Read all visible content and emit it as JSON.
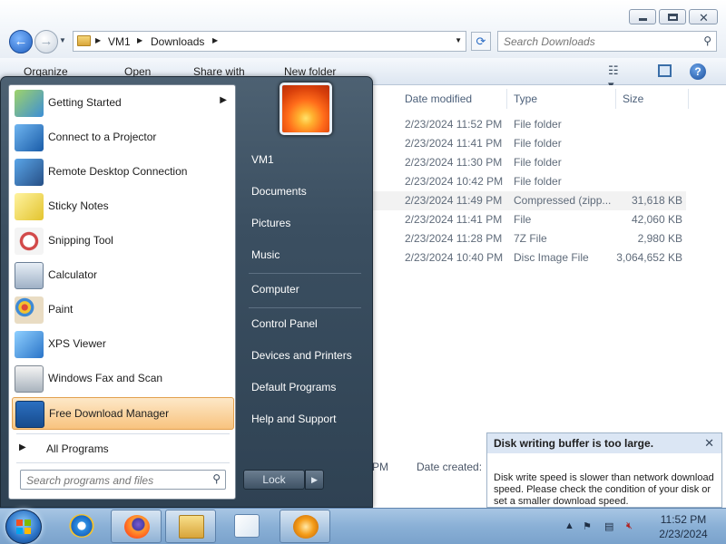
{
  "explorer": {
    "address": {
      "crumbs": [
        "VM1",
        "Downloads"
      ]
    },
    "search": {
      "placeholder": "Search Downloads"
    },
    "toolbar": {
      "organize": "Organize",
      "open": "Open",
      "share_with": "Share with",
      "new_folder": "New folder"
    },
    "columns": {
      "date_modified": "Date modified",
      "type": "Type",
      "size": "Size"
    },
    "files": [
      {
        "date": "2/23/2024 11:52 PM",
        "type": "File folder",
        "size": ""
      },
      {
        "date": "2/23/2024 11:41 PM",
        "type": "File folder",
        "size": ""
      },
      {
        "date": "2/23/2024 11:30 PM",
        "type": "File folder",
        "size": ""
      },
      {
        "date": "2/23/2024 10:42 PM",
        "type": "File folder",
        "size": ""
      },
      {
        "date": "2/23/2024 11:49 PM",
        "type": "Compressed (zipp...",
        "size": "31,618 KB"
      },
      {
        "date": "2/23/2024 11:41 PM",
        "type": "File",
        "size": "42,060 KB"
      },
      {
        "date": "2/23/2024 11:28 PM",
        "type": "7Z File",
        "size": "2,980 KB"
      },
      {
        "date": "2/23/2024 10:40 PM",
        "type": "Disc Image File",
        "size": "3,064,652 KB"
      }
    ],
    "details": {
      "time_fragment": "PM",
      "date_created_label": "Date created:"
    }
  },
  "start_menu": {
    "programs": [
      {
        "label": "Getting Started",
        "icon": "getting-started-icon"
      },
      {
        "label": "Connect to a Projector",
        "icon": "projector-icon"
      },
      {
        "label": "Remote Desktop Connection",
        "icon": "remote-desktop-icon"
      },
      {
        "label": "Sticky Notes",
        "icon": "sticky-notes-icon"
      },
      {
        "label": "Snipping Tool",
        "icon": "snipping-tool-icon"
      },
      {
        "label": "Calculator",
        "icon": "calculator-icon"
      },
      {
        "label": "Paint",
        "icon": "paint-icon"
      },
      {
        "label": "XPS Viewer",
        "icon": "xps-viewer-icon"
      },
      {
        "label": "Windows Fax and Scan",
        "icon": "fax-scan-icon"
      },
      {
        "label": "Free Download Manager",
        "icon": "free-download-manager-icon"
      }
    ],
    "all_programs": "All Programs",
    "search_placeholder": "Search programs and files",
    "right_items": [
      "VM1",
      "Documents",
      "Pictures",
      "Music",
      "Computer",
      "Control Panel",
      "Devices and Printers",
      "Default Programs",
      "Help and Support"
    ],
    "lock_label": "Lock"
  },
  "notification": {
    "title": "Disk writing buffer is too large.",
    "body": "Disk write speed is slower than network download speed. Please check the condition of your disk or set a smaller download speed."
  },
  "taskbar": {
    "apps": [
      "internet-explorer-icon",
      "firefox-icon",
      "windows-explorer-icon",
      "media-player-icon",
      "free-download-manager-icon"
    ],
    "clock": {
      "time": "11:52 PM",
      "date": "2/23/2024"
    }
  },
  "colors": {
    "start_menu_bg": "#3b4f61",
    "highlight": "#f8c37e",
    "taskbar": "#8ab0d6",
    "popup_header": "#dbe6f4"
  }
}
